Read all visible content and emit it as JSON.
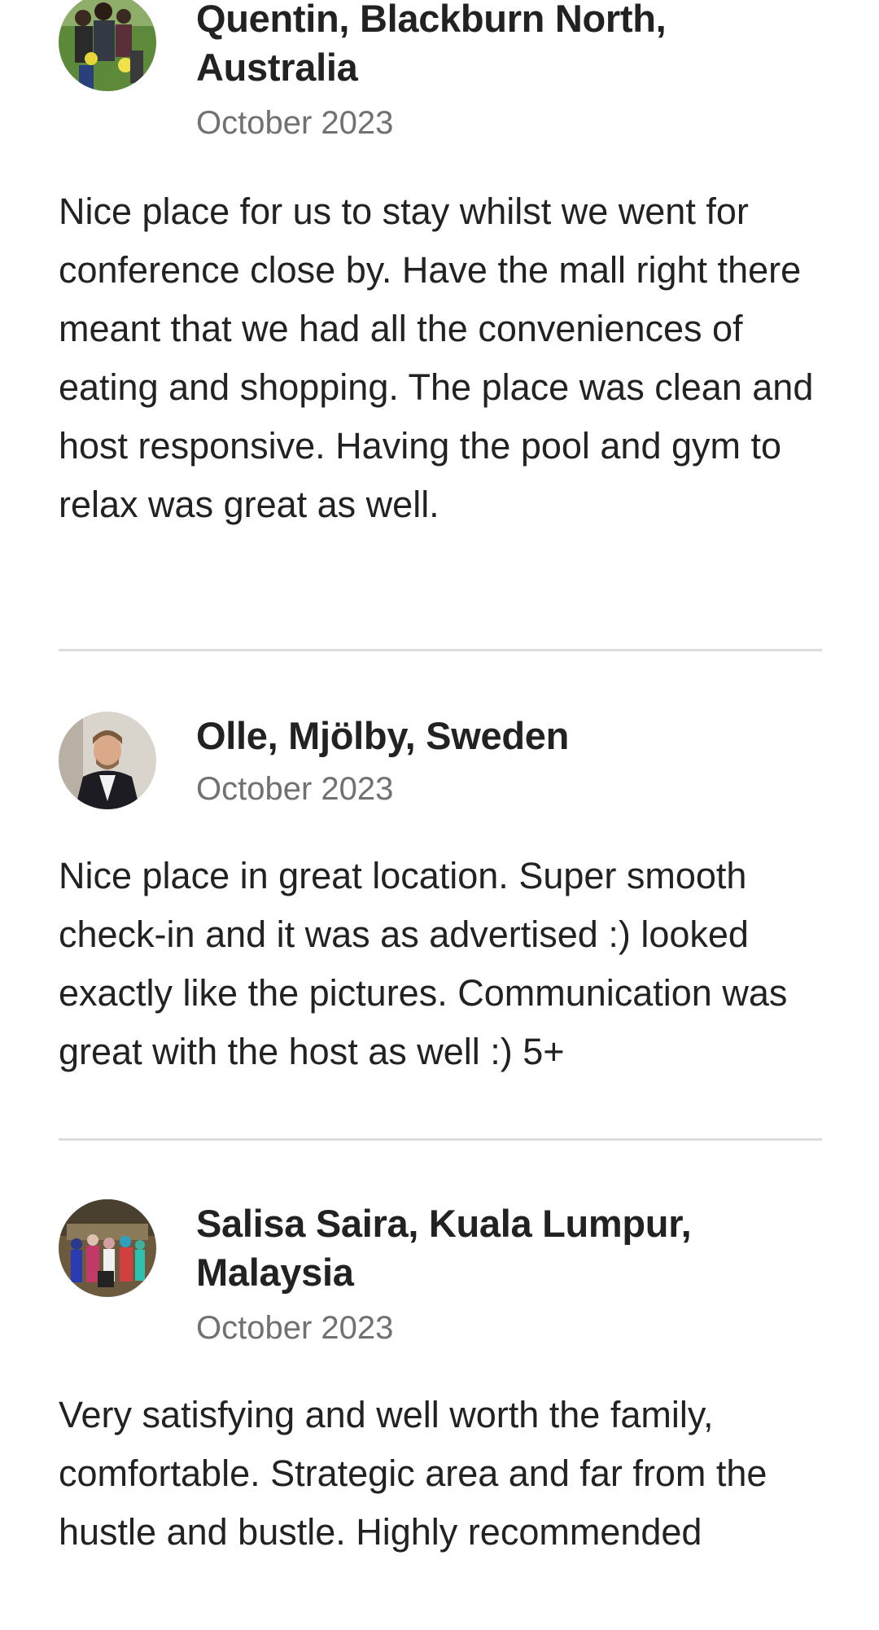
{
  "reviews": [
    {
      "name": "Quentin, Blackburn North, Australia",
      "date": "October 2023",
      "text": "Nice place for us to stay whilst we went for conference close by. Have the mall right there meant that we had all the conveniences of eating and shopping. The place was clean and host responsive. Having the pool and gym to relax was great as well.",
      "avatar_icon": "family-photo-avatar"
    },
    {
      "name": "Olle, Mjölby, Sweden",
      "date": "October 2023",
      "text": "Nice place in great location. Super smooth check-in and it was as advertised :) looked exactly like the pictures. Communication was great with the host as well :) 5+",
      "avatar_icon": "man-portrait-avatar"
    },
    {
      "name": "Salisa Saira, Kuala Lumpur, Malaysia",
      "date": "October 2023",
      "text": "Very satisfying and well worth the family, comfortable. Strategic area and far from the hustle and bustle. Highly recommended",
      "avatar_icon": "group-photo-avatar"
    }
  ],
  "colors": {
    "text_primary": "#222222",
    "text_secondary": "#717171",
    "divider": "#dddddd",
    "background": "#ffffff"
  }
}
